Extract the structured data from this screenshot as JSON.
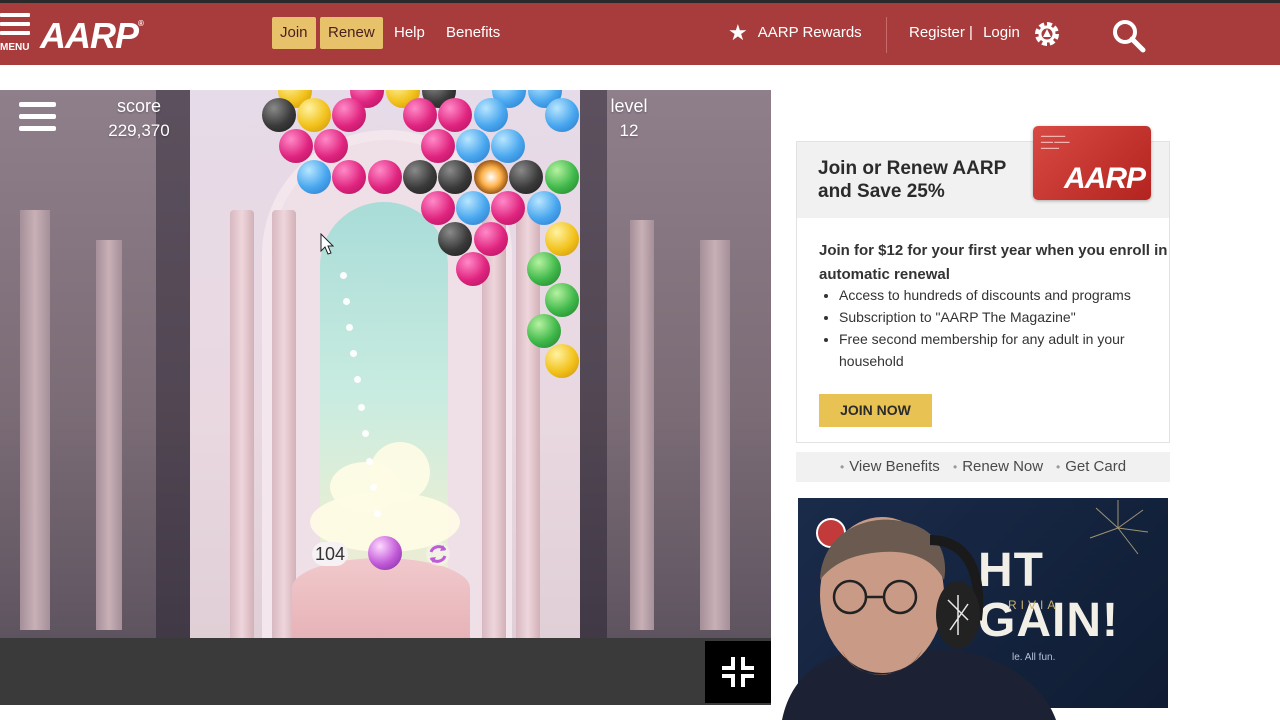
{
  "header": {
    "menu_label": "MENU",
    "logo": "AARP",
    "logo_mark": "®",
    "join_label": "Join",
    "renew_label": "Renew",
    "help_label": "Help",
    "benefits_label": "Benefits",
    "rewards_label": "AARP Rewards",
    "register_label": "Register |",
    "login_label": "Login",
    "colors": {
      "bar": "#a83c3c",
      "pill": "#e8c26a"
    }
  },
  "game": {
    "score_label": "score",
    "score_value": "229,370",
    "level_label": "level",
    "level_value": "12",
    "shots_remaining": "104",
    "ball_colors": {
      "pink": "#e0247f",
      "blue": "#48a6ee",
      "black": "#3a3a3a",
      "yellow": "#f2c21c",
      "green": "#3fb84a"
    }
  },
  "promo": {
    "title": "Join or Renew AARP and Save 25%",
    "card_logo": "AARP",
    "lead": "Join for $12 for your first year when you enroll in automatic renewal",
    "bullets": [
      "Access to hundreds of discounts and programs",
      "Subscription to \"AARP The Magazine\"",
      "Free second membership for any adult in your household"
    ],
    "join_now_label": "JOIN NOW",
    "links": [
      "View Benefits",
      "Renew Now",
      "Get Card"
    ]
  },
  "ad": {
    "headline_1": "HT",
    "headline_2": "GAIN!",
    "trivia": "RIVIA",
    "tagline": "le. All fun."
  }
}
